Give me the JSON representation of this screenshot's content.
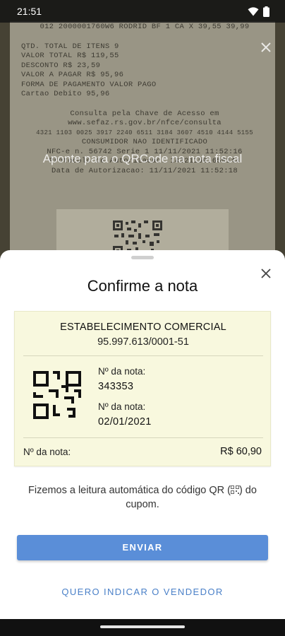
{
  "status_bar": {
    "time": "21:51",
    "icons": [
      "wifi-icon",
      "battery-icon"
    ]
  },
  "camera": {
    "prompt": "Aponte para o QRCode na nota fiscal",
    "receipt_lines": [
      "012  2000001760W6 RODRID BF     1 CA X   39,55   39,99",
      "QTD. TOTAL DE ITENS                             9",
      "VALOR TOTAL R$                             119,55",
      "DESCONTO R$                                 23,59",
      "VALOR A PAGAR R$                            95,96",
      "FORMA DE PAGAMENTO                     VALOR PAGO",
      "Cartao Debito                               95,96",
      "Consulta pela Chave de Acesso em",
      "www.sefaz.rs.gov.br/nfce/consulta",
      "4321 1103 0025 3917 2240 6511 3184 3607 4510 4144 5155",
      "CONSUMIDOR NAO IDENTIFICADO",
      "NFC-e n. 56742 Serie 1   11/11/2021 11:52:16",
      "Protocolo de Autorizacao: 143211501650144",
      "Data de Autorizacao: 11/11/2021 11:52:18"
    ]
  },
  "sheet": {
    "title": "Confirme a nota",
    "card": {
      "store_name": "ESTABELECIMENTO COMERCIAL",
      "cnpj": "95.997.613/0001-51",
      "fields": [
        {
          "label": "Nº da nota:",
          "value": "343353"
        },
        {
          "label": "Nº da nota:",
          "value": "02/01/2021"
        }
      ],
      "total_label": "Nº da nota:",
      "total_value": "R$  60,90"
    },
    "info_text_before": "Fizemos a leitura automática do código QR (",
    "info_text_after": ") do cupom.",
    "send_button": "ENVIAR",
    "seller_link": "QUERO INDICAR O VENDEDOR"
  },
  "colors": {
    "primary": "#5a8ed8",
    "link": "#4a80c8",
    "card_bg": "#f8f8de"
  }
}
